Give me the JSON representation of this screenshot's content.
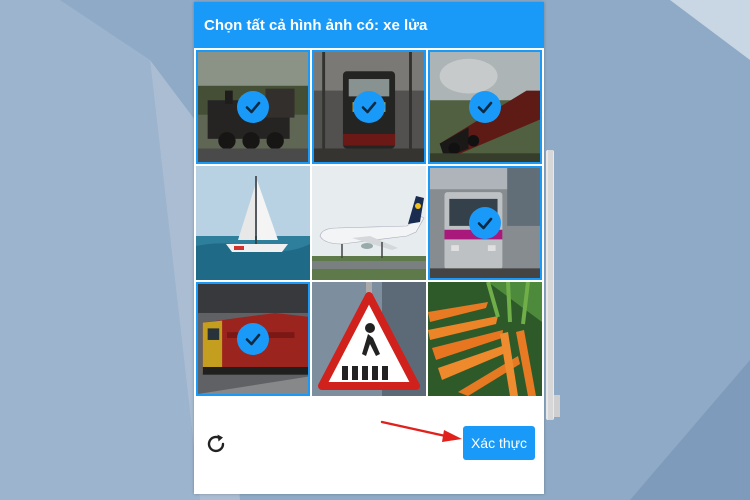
{
  "captcha": {
    "title": "Chọn tất cả hình ảnh có: xe lửa",
    "verify_label": "Xác thực",
    "refresh_icon": "refresh-icon",
    "tiles": [
      {
        "subject": "steam-train-locomotive",
        "selected": true
      },
      {
        "subject": "train-front-view",
        "selected": true
      },
      {
        "subject": "steam-train-in-forest",
        "selected": true
      },
      {
        "subject": "sailboat",
        "selected": false
      },
      {
        "subject": "airplane",
        "selected": false
      },
      {
        "subject": "commuter-train",
        "selected": true
      },
      {
        "subject": "diesel-locomotive",
        "selected": true
      },
      {
        "subject": "pedestrian-crossing-sign",
        "selected": false
      },
      {
        "subject": "carrots",
        "selected": false
      }
    ]
  },
  "colors": {
    "accent": "#1a9af8",
    "annotation_arrow": "#e0211c",
    "background": "#8faac6"
  }
}
